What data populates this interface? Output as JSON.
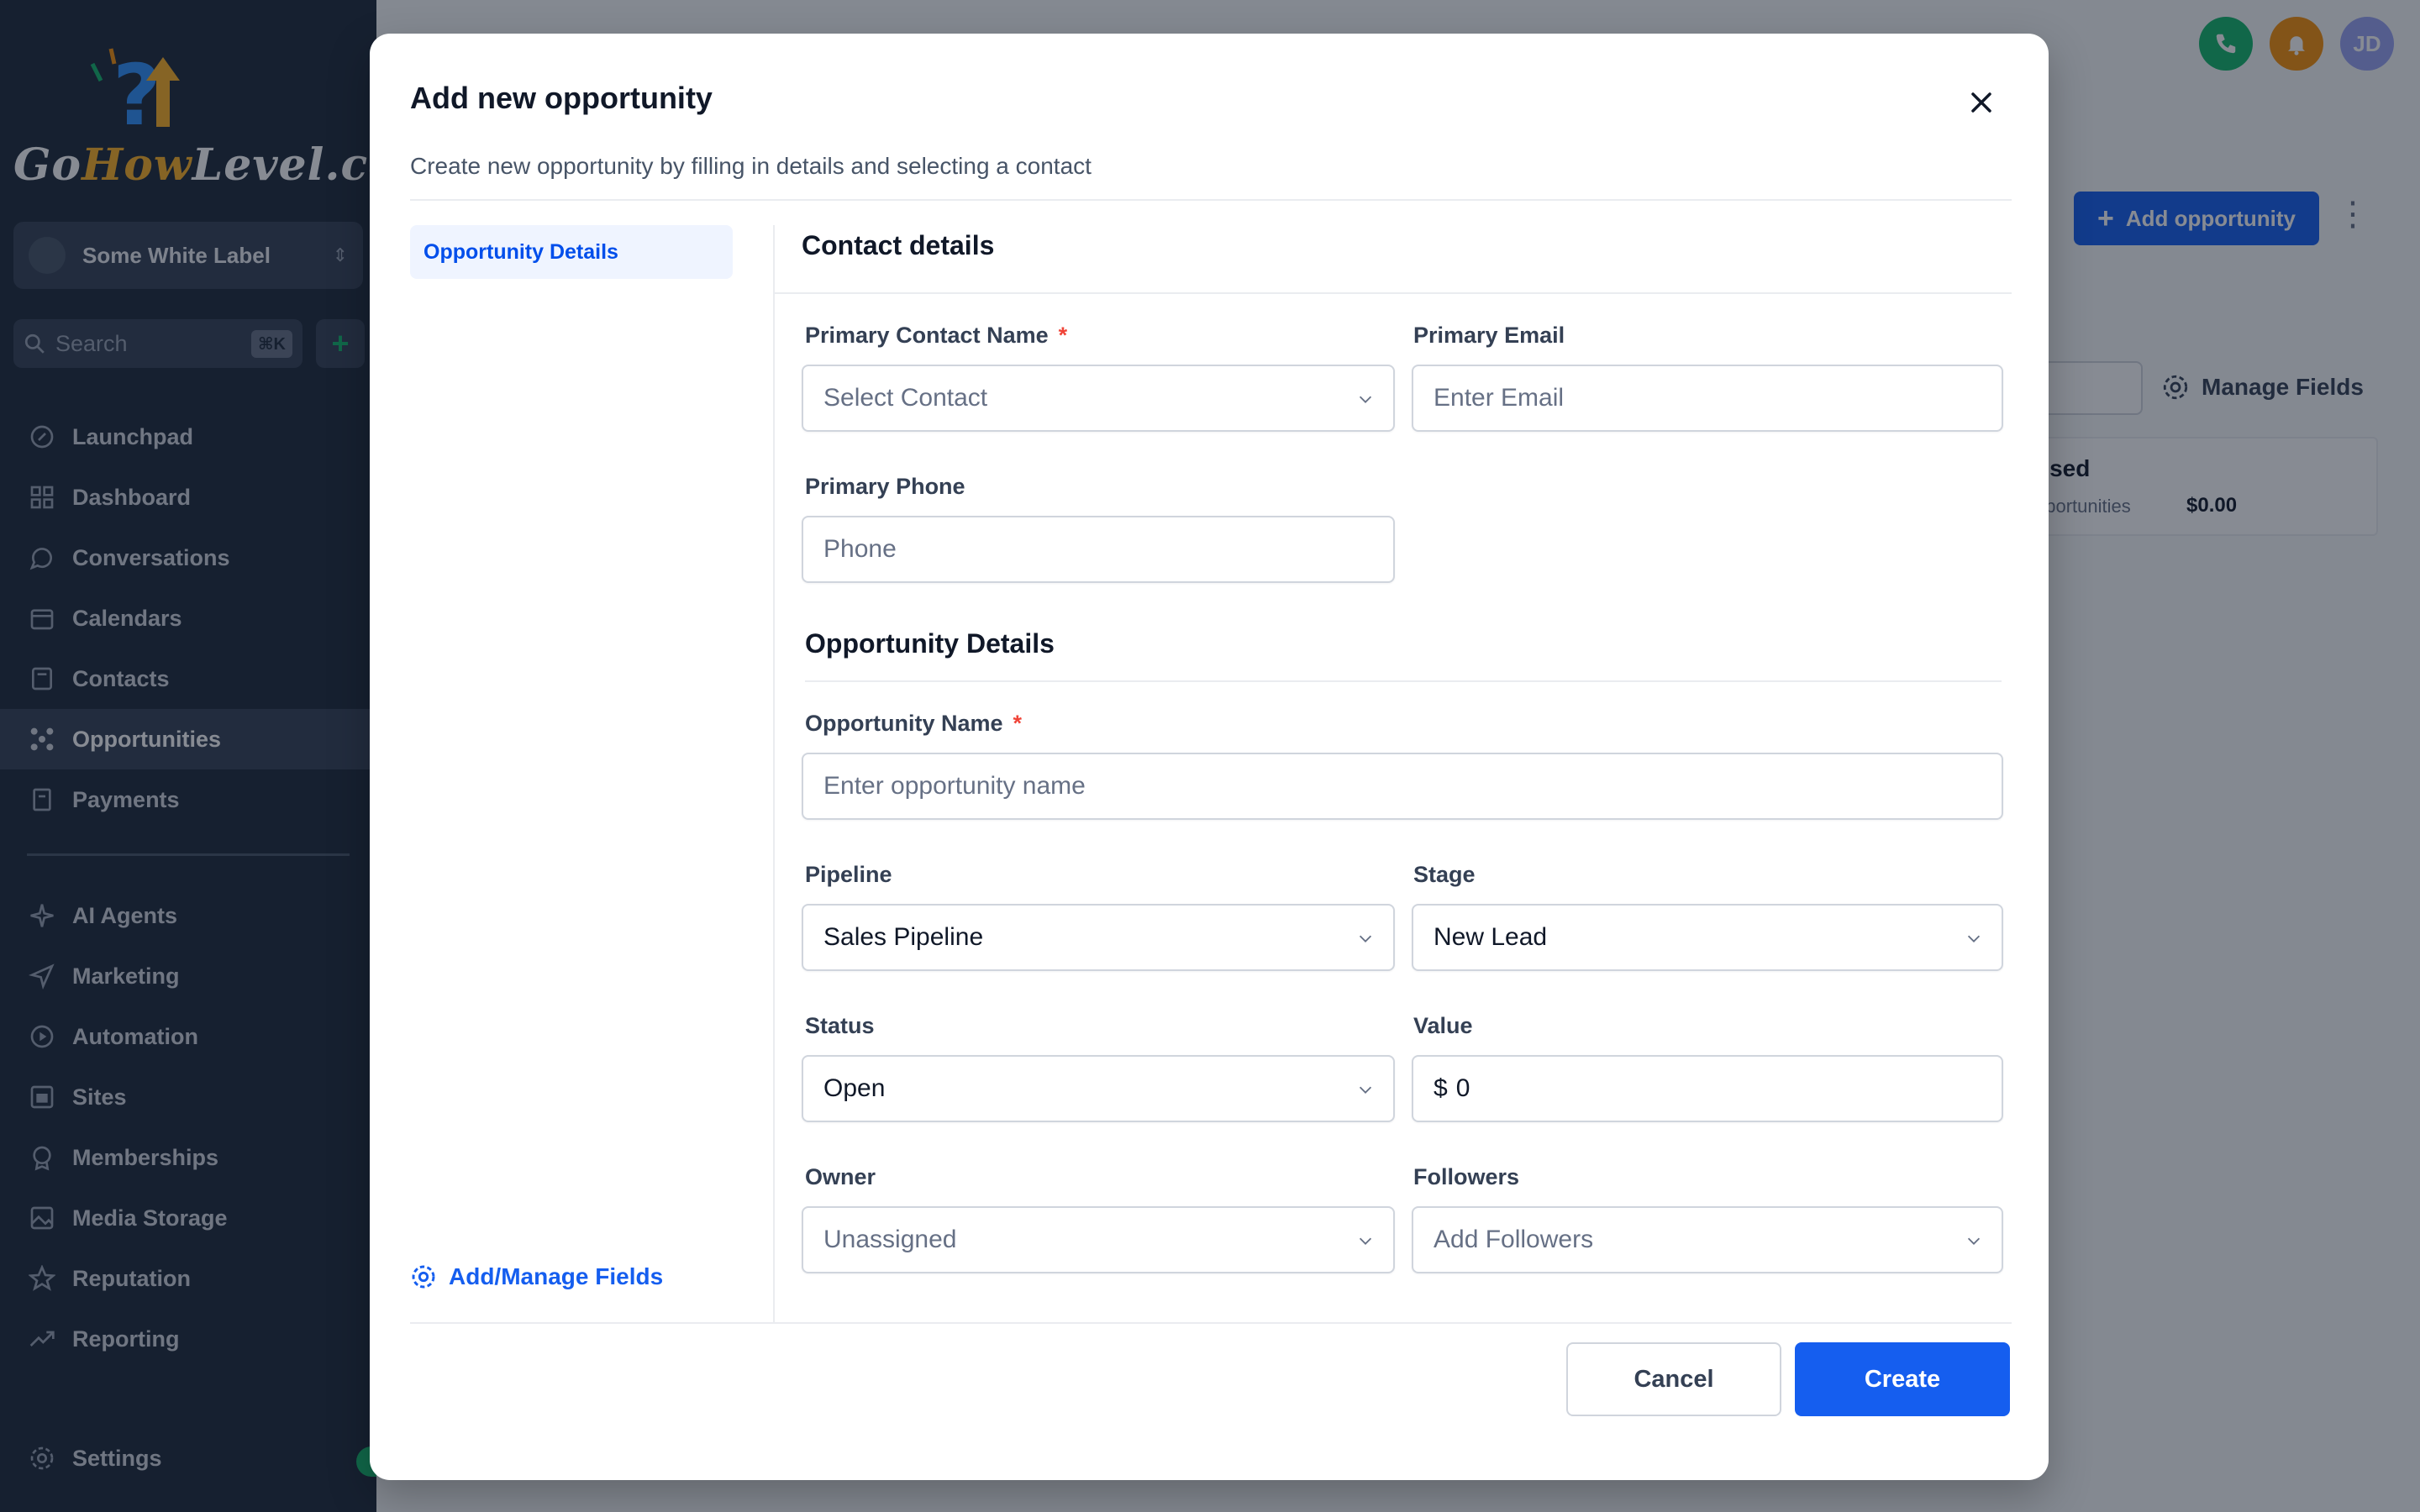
{
  "sidebar": {
    "logo_text_a": "Go",
    "logo_text_b": "How",
    "logo_text_c": "Level.com",
    "location_name": "Some White Label",
    "search_placeholder": "Search",
    "search_shortcut": "⌘K",
    "quick_add": "+",
    "nav_items": [
      {
        "label": "Launchpad",
        "icon": "rocket-icon"
      },
      {
        "label": "Dashboard",
        "icon": "dashboard-icon"
      },
      {
        "label": "Conversations",
        "icon": "chat-icon"
      },
      {
        "label": "Calendars",
        "icon": "calendar-icon"
      },
      {
        "label": "Contacts",
        "icon": "contacts-icon"
      },
      {
        "label": "Opportunities",
        "icon": "opportunities-icon",
        "active": true
      },
      {
        "label": "Payments",
        "icon": "payments-icon"
      }
    ],
    "nav_items_2": [
      {
        "label": "AI Agents",
        "icon": "sparkle-icon"
      },
      {
        "label": "Marketing",
        "icon": "send-icon"
      },
      {
        "label": "Automation",
        "icon": "automation-icon"
      },
      {
        "label": "Sites",
        "icon": "sites-icon"
      },
      {
        "label": "Memberships",
        "icon": "membership-icon"
      },
      {
        "label": "Media Storage",
        "icon": "image-icon"
      },
      {
        "label": "Reputation",
        "icon": "star-icon"
      },
      {
        "label": "Reporting",
        "icon": "trend-icon"
      }
    ],
    "settings_label": "Settings"
  },
  "topbar": {
    "avatar_initials": "JD",
    "colors": {
      "phone": "#12b76a",
      "bell": "#f79009",
      "avatar": "#98a2f3"
    }
  },
  "background": {
    "add_opportunity_label": "Add opportunity",
    "manage_fields_label": "Manage Fields",
    "card_title": "osed",
    "card_sub": "pportunities",
    "card_value": "$0.00"
  },
  "modal": {
    "title": "Add new opportunity",
    "subtitle": "Create new opportunity by filling in details and selecting a contact",
    "tab_label": "Opportunity Details",
    "manage_fields_label": "Add/Manage Fields",
    "contact_section_title": "Contact details",
    "primary_contact_label": "Primary Contact Name",
    "primary_contact_placeholder": "Select Contact",
    "primary_email_label": "Primary Email",
    "primary_email_placeholder": "Enter Email",
    "primary_phone_label": "Primary Phone",
    "primary_phone_placeholder": "Phone",
    "opportunity_section_title": "Opportunity Details",
    "opportunity_name_label": "Opportunity Name",
    "opportunity_name_placeholder": "Enter opportunity name",
    "pipeline_label": "Pipeline",
    "pipeline_value": "Sales Pipeline",
    "stage_label": "Stage",
    "stage_value": "New Lead",
    "status_label": "Status",
    "status_value": "Open",
    "value_label": "Value",
    "value_prefix": "$",
    "value_value": "0",
    "owner_label": "Owner",
    "owner_value": "Unassigned",
    "followers_label": "Followers",
    "followers_placeholder": "Add Followers",
    "required_mark": "*",
    "cancel_label": "Cancel",
    "create_label": "Create",
    "accent_color": "#155eef"
  }
}
